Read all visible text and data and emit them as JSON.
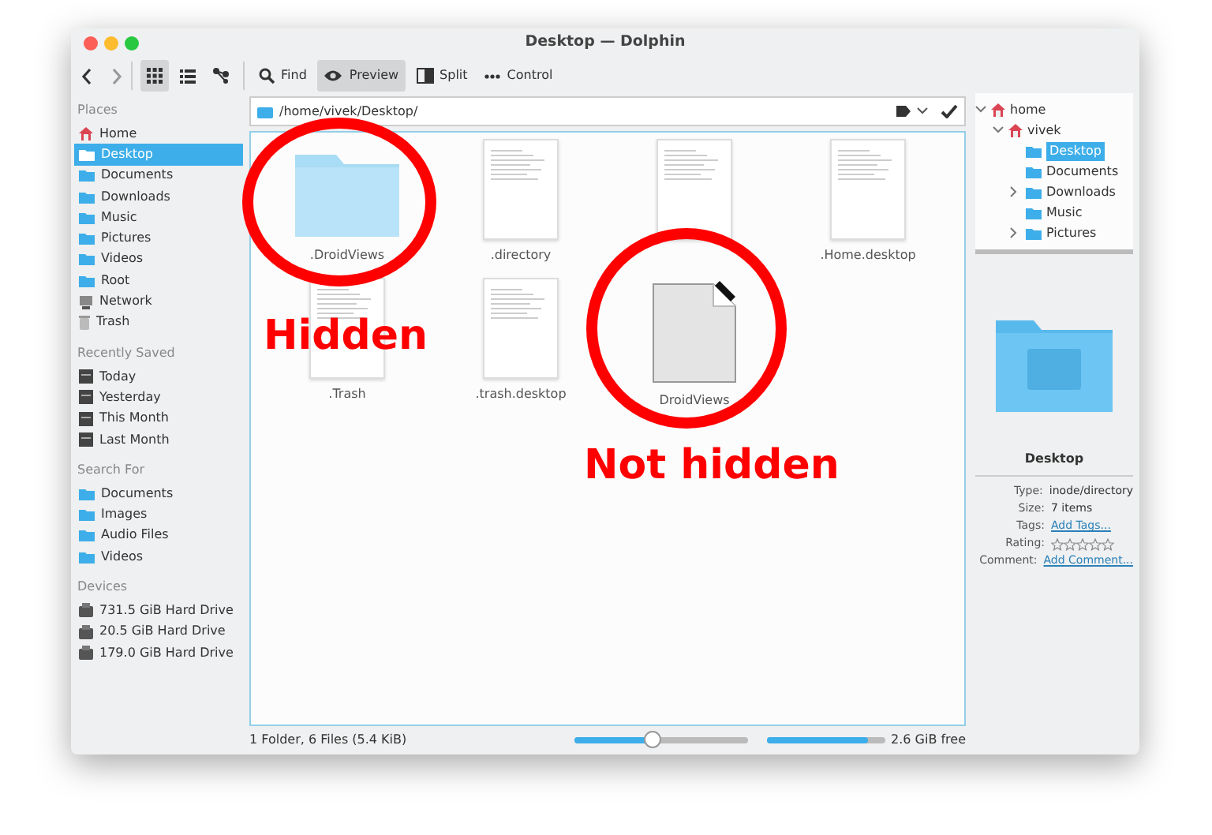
{
  "window": {
    "title": "Desktop — Dolphin"
  },
  "toolbar": {
    "views": [
      {
        "kind": "icons",
        "selected": true
      },
      {
        "kind": "details",
        "selected": false
      },
      {
        "kind": "tree",
        "selected": false
      }
    ],
    "actions": [
      {
        "kind": "find",
        "label": "Find",
        "selected": false
      },
      {
        "kind": "preview",
        "label": "Preview",
        "selected": true
      },
      {
        "kind": "split",
        "label": "Split",
        "selected": false
      },
      {
        "kind": "control",
        "label": "Control",
        "selected": false
      }
    ]
  },
  "sidebar": [
    {
      "heading": "Places",
      "items": [
        {
          "label": "Home",
          "kind": "home",
          "selected": false
        },
        {
          "label": "Desktop",
          "kind": "folder",
          "selected": true
        },
        {
          "label": "Documents",
          "kind": "folder",
          "selected": false
        },
        {
          "label": "Downloads",
          "kind": "folder",
          "selected": false
        },
        {
          "label": "Music",
          "kind": "folder",
          "selected": false
        },
        {
          "label": "Pictures",
          "kind": "folder",
          "selected": false
        },
        {
          "label": "Videos",
          "kind": "folder",
          "selected": false
        },
        {
          "label": "Root",
          "kind": "folder",
          "selected": false
        },
        {
          "label": "Network",
          "kind": "network",
          "selected": false
        },
        {
          "label": "Trash",
          "kind": "trash",
          "selected": false
        }
      ]
    },
    {
      "heading": "Recently Saved",
      "items": [
        {
          "label": "Today",
          "kind": "calendar",
          "selected": false
        },
        {
          "label": "Yesterday",
          "kind": "calendar",
          "selected": false
        },
        {
          "label": "This Month",
          "kind": "calendar",
          "selected": false
        },
        {
          "label": "Last Month",
          "kind": "calendar",
          "selected": false
        }
      ]
    },
    {
      "heading": "Search For",
      "items": [
        {
          "label": "Documents",
          "kind": "folder",
          "selected": false
        },
        {
          "label": "Images",
          "kind": "folder",
          "selected": false
        },
        {
          "label": "Audio Files",
          "kind": "folder",
          "selected": false
        },
        {
          "label": "Videos",
          "kind": "folder",
          "selected": false
        }
      ]
    },
    {
      "heading": "Devices",
      "items": [
        {
          "label": "731.5 GiB Hard Drive",
          "kind": "drive",
          "selected": false
        },
        {
          "label": "20.5 GiB Hard Drive",
          "kind": "drive",
          "selected": false
        },
        {
          "label": "179.0 GiB Hard Drive",
          "kind": "drive",
          "selected": false
        }
      ]
    }
  ],
  "location": {
    "path": "/home/vivek/Desktop/"
  },
  "files": [
    {
      "name": ".DroidViews",
      "kind": "folder"
    },
    {
      "name": ".directory",
      "kind": "text"
    },
    {
      "kind": "text"
    },
    {
      "name": ".Home.desktop",
      "kind": "text"
    },
    {
      "name": ".Trash",
      "kind": "text"
    },
    {
      "name": ".trash.desktop",
      "kind": "text"
    },
    {
      "name": "DroidViews",
      "kind": "blank"
    }
  ],
  "annotations": [
    {
      "text": "Hidden"
    },
    {
      "text": "Not hidden"
    }
  ],
  "tree": [
    {
      "label": "home",
      "expanded": true,
      "selected": false,
      "children": [
        {
          "label": "vivek",
          "expanded": true,
          "selected": false,
          "children": [
            {
              "label": "Desktop",
              "selected": true
            },
            {
              "label": "Documents",
              "selected": false
            },
            {
              "label": "Downloads",
              "expanded": false,
              "selected": false
            },
            {
              "label": "Music",
              "selected": false
            },
            {
              "label": "Pictures",
              "expanded": false,
              "selected": false
            }
          ]
        }
      ]
    }
  ],
  "info": {
    "name": "Desktop",
    "rows": [
      {
        "label": "Type:",
        "value": "inode/directory",
        "kind": "text"
      },
      {
        "label": "Size:",
        "value": "7 items",
        "kind": "text"
      },
      {
        "label": "Tags:",
        "value": "Add Tags...",
        "kind": "link"
      },
      {
        "label": "Rating:",
        "stars": 0,
        "kind": "stars"
      },
      {
        "label": "Comment:",
        "value": "Add Comment...",
        "kind": "link"
      }
    ]
  },
  "status": {
    "text": "1 Folder, 6 Files (5.4 KiB)",
    "zoom": {
      "level": 0.45
    },
    "space": {
      "level": 0.86
    },
    "free": "2.6 GiB free"
  }
}
